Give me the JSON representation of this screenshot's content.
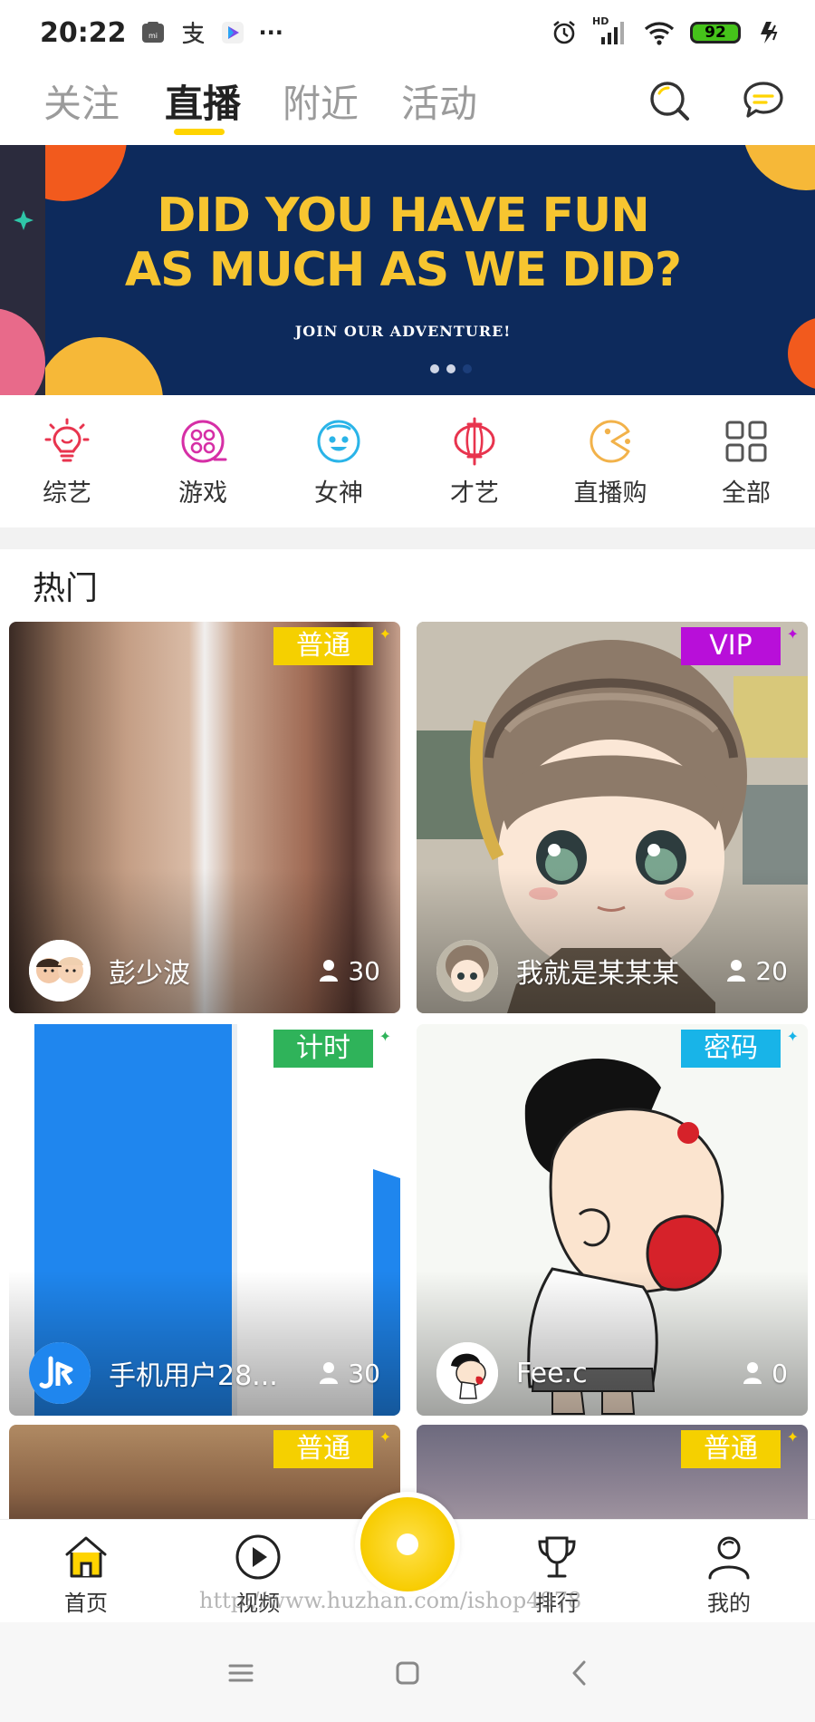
{
  "status_bar": {
    "time": "20:22",
    "network": "HD",
    "battery": "92",
    "more": "···"
  },
  "top_nav": {
    "tabs": [
      {
        "label": "关注"
      },
      {
        "label": "直播"
      },
      {
        "label": "附近"
      },
      {
        "label": "活动"
      }
    ],
    "active_tab": "直播",
    "accent": "#ffd400"
  },
  "banner": {
    "title_line1": "DID YOU HAVE FUN",
    "title_line2": "AS MUCH AS WE DID?",
    "subtitle": "JOIN OUR ADVENTURE!",
    "page_count": 3,
    "active_page": 3,
    "background": "#0d2a5c",
    "title_color": "#f7c530"
  },
  "categories": [
    {
      "label": "综艺",
      "icon": "lightbulb-icon",
      "color": "#e8344e"
    },
    {
      "label": "游戏",
      "icon": "film-reel-icon",
      "color": "#d62fa6"
    },
    {
      "label": "女神",
      "icon": "smiley-face-icon",
      "color": "#2ab4e8"
    },
    {
      "label": "才艺",
      "icon": "lantern-icon",
      "color": "#e8344e"
    },
    {
      "label": "直播购",
      "icon": "pacman-icon",
      "color": "#f2b24a"
    },
    {
      "label": "全部",
      "icon": "grid-icon",
      "color": "#555555"
    }
  ],
  "section_title": "热门",
  "cards": [
    {
      "badge": "普通",
      "badge_color": "#f5d000",
      "name": "彭少波",
      "viewers": "30",
      "avatar": "avatar-two-kids"
    },
    {
      "badge": "VIP",
      "badge_color": "#b80fd9",
      "name": "我就是某某某",
      "viewers": "20",
      "avatar": "avatar-anime"
    },
    {
      "badge": "计时",
      "badge_color": "#2fb35a",
      "name": "手机用户28...",
      "viewers": "30",
      "avatar": "avatar-logo"
    },
    {
      "badge": "密码",
      "badge_color": "#18b4e8",
      "name": "Fee.c",
      "viewers": "0",
      "avatar": "avatar-cartoon"
    },
    {
      "badge": "普通",
      "badge_color": "#f5d000"
    },
    {
      "badge": "普通",
      "badge_color": "#f5d000"
    }
  ],
  "bottom_nav": [
    {
      "label": "首页",
      "icon": "home-icon"
    },
    {
      "label": "视频",
      "icon": "play-icon"
    },
    {
      "label": "排行",
      "icon": "trophy-icon"
    },
    {
      "label": "我的",
      "icon": "profile-icon"
    }
  ],
  "watermark": "http://www.huzhan.com/ishop4978"
}
